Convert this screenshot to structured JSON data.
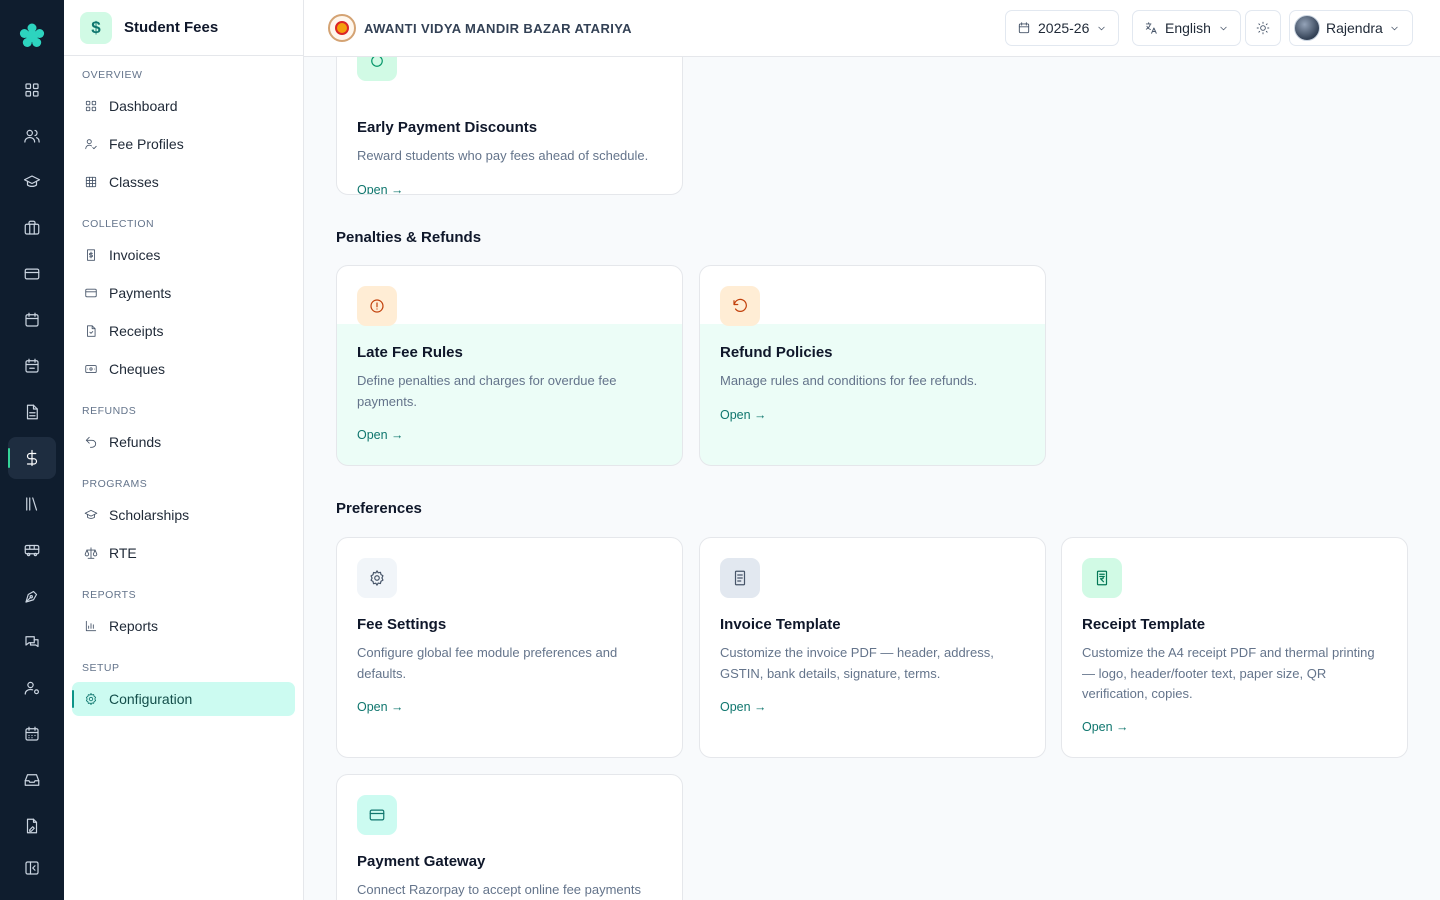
{
  "rail": {
    "items": [
      "dashboard-icon",
      "users-icon",
      "graduation-cap-icon",
      "briefcase-icon",
      "credit-card-icon",
      "calendar-icon",
      "calendar-check-icon",
      "file-text-icon",
      "dollar-icon",
      "library-icon",
      "bus-icon",
      "pen-tool-icon",
      "messages-icon",
      "user-cog-icon",
      "calendar-grid-icon",
      "inbox-icon",
      "file-edit-icon",
      "panel-collapse-icon"
    ],
    "active_index": 8
  },
  "sidebar": {
    "title": "Student Fees",
    "sections": {
      "overview": "OVERVIEW",
      "collection": "COLLECTION",
      "refunds": "REFUNDS",
      "programs": "PROGRAMS",
      "reports": "REPORTS",
      "setup": "SETUP"
    },
    "items": {
      "dashboard": "Dashboard",
      "fee_profiles": "Fee Profiles",
      "classes": "Classes",
      "invoices": "Invoices",
      "payments": "Payments",
      "receipts": "Receipts",
      "cheques": "Cheques",
      "refunds": "Refunds",
      "scholarships": "Scholarships",
      "rte": "RTE",
      "reports": "Reports",
      "configuration": "Configuration"
    },
    "active": "configuration"
  },
  "topbar": {
    "school_name": "AWANTI VIDYA MANDIR BAZAR ATARIYA",
    "year": "2025-26",
    "language": "English",
    "user": "Rajendra"
  },
  "content": {
    "sections": {
      "penalties": "Penalties & Refunds",
      "preferences": "Preferences"
    },
    "open_label": "Open →",
    "cards": {
      "early_payment": {
        "title": "Early Payment Discounts",
        "desc": "Reward students who pay fees ahead of schedule."
      },
      "late_fee": {
        "title": "Late Fee Rules",
        "desc": "Define penalties and charges for overdue fee payments."
      },
      "refund_policies": {
        "title": "Refund Policies",
        "desc": "Manage rules and conditions for fee refunds."
      },
      "fee_settings": {
        "title": "Fee Settings",
        "desc": "Configure global fee module preferences and defaults."
      },
      "invoice_template": {
        "title": "Invoice Template",
        "desc": "Customize the invoice PDF — header, address, GSTIN, bank details, signature, terms."
      },
      "receipt_template": {
        "title": "Receipt Template",
        "desc": "Customize the A4 receipt PDF and thermal printing — logo, header/footer text, paper size, QR verification, copies."
      },
      "payment_gateway": {
        "title": "Payment Gateway",
        "desc": "Connect Razorpay to accept online fee payments"
      }
    }
  },
  "colors": {
    "rail_bg": "#0f1d2e",
    "accent": "#0f766e",
    "accent_soft": "#ccfbf1",
    "highlight_card": "#ecfdf7"
  }
}
